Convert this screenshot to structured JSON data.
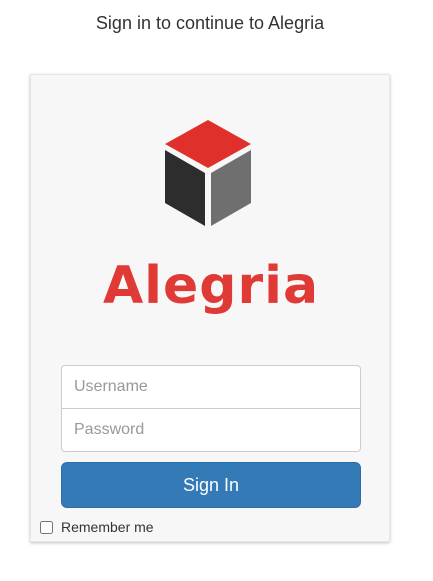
{
  "page": {
    "heading": "Sign in to continue to Alegria"
  },
  "logo": {
    "icon": "cube-icon",
    "text": "Alegria",
    "colors": {
      "text": "#e03a36",
      "cube_top": "#e0302c",
      "cube_left": "#2d2d2d",
      "cube_right": "#6f6f6f"
    }
  },
  "form": {
    "username_placeholder": "Username",
    "username_value": "",
    "password_placeholder": "Password",
    "password_value": "",
    "submit_label": "Sign In",
    "remember_label": "Remember me",
    "remember_checked": false
  },
  "colors": {
    "primary": "#337ab7",
    "card_background": "#f7f7f7"
  }
}
